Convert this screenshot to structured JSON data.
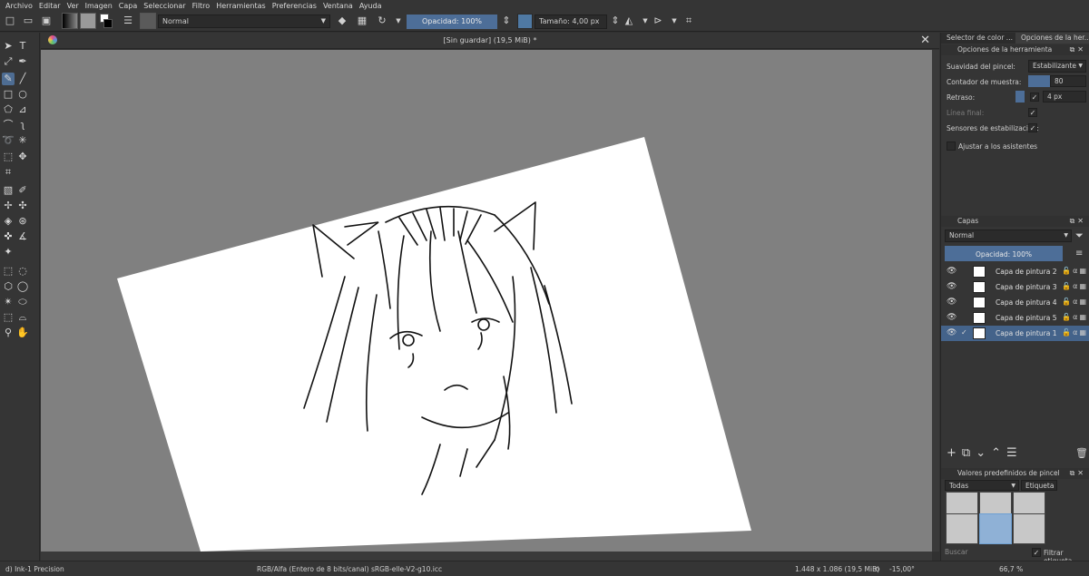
{
  "menu": [
    "Archivo",
    "Editar",
    "Ver",
    "Imagen",
    "Capa",
    "Seleccionar",
    "Filtro",
    "Herramientas",
    "Preferencias",
    "Ventana",
    "Ayuda"
  ],
  "toolbar": {
    "blend_mode": "Normal",
    "opacity_label": "Opacidad: 100%",
    "opacity_value": 1.0,
    "size_label": "Tamaño: 4,00 px",
    "brush_color": "#4f79a3"
  },
  "document": {
    "title": "[Sin guardar]  (19,5 MiB) *",
    "close_glyph": "✕"
  },
  "right_panel": {
    "tabs": [
      "Selector de color ...",
      "Opciones de la her..."
    ],
    "tool_options": {
      "header": "Opciones de la herramienta",
      "smoothing_label": "Suavidad del pincel:",
      "smoothing_value": "Estabilizante",
      "sample_count_label": "Contador de muestra:",
      "sample_count_value": "80",
      "delay_label": "Retraso:",
      "delay_value": "4 px",
      "finish_line_label": "Línea final:",
      "stabilize_sensors_label": "Sensores de estabilización:",
      "snap_assistants_label": "Ajustar a los asistentes"
    },
    "layers": {
      "header": "Capas",
      "blend_mode": "Normal",
      "opacity_label": "Opacidad:  100%",
      "items": [
        {
          "name": "Capa de pintura 2",
          "selected": false
        },
        {
          "name": "Capa de pintura 3",
          "selected": false
        },
        {
          "name": "Capa de pintura 4",
          "selected": false
        },
        {
          "name": "Capa de pintura 5",
          "selected": false
        },
        {
          "name": "Capa de pintura 1",
          "selected": true
        }
      ]
    },
    "brush_presets": {
      "header": "Valores predefinidos de pincel",
      "filter_value": "Todas",
      "tag_label": "Etiqueta",
      "search_placeholder": "Buscar",
      "filter_tag_label": "Filtrar etiqueta"
    }
  },
  "status": {
    "brush_name": "d) Ink-1 Precision",
    "color_space": "RGB/Alfa (Entero de 8 bits/canal)  sRGB-elle-V2-g10.icc",
    "dimensions": "1.448 x 1.086 (19,5 MiB)",
    "rotation": "-15,00°",
    "zoom": "66,7 %"
  }
}
